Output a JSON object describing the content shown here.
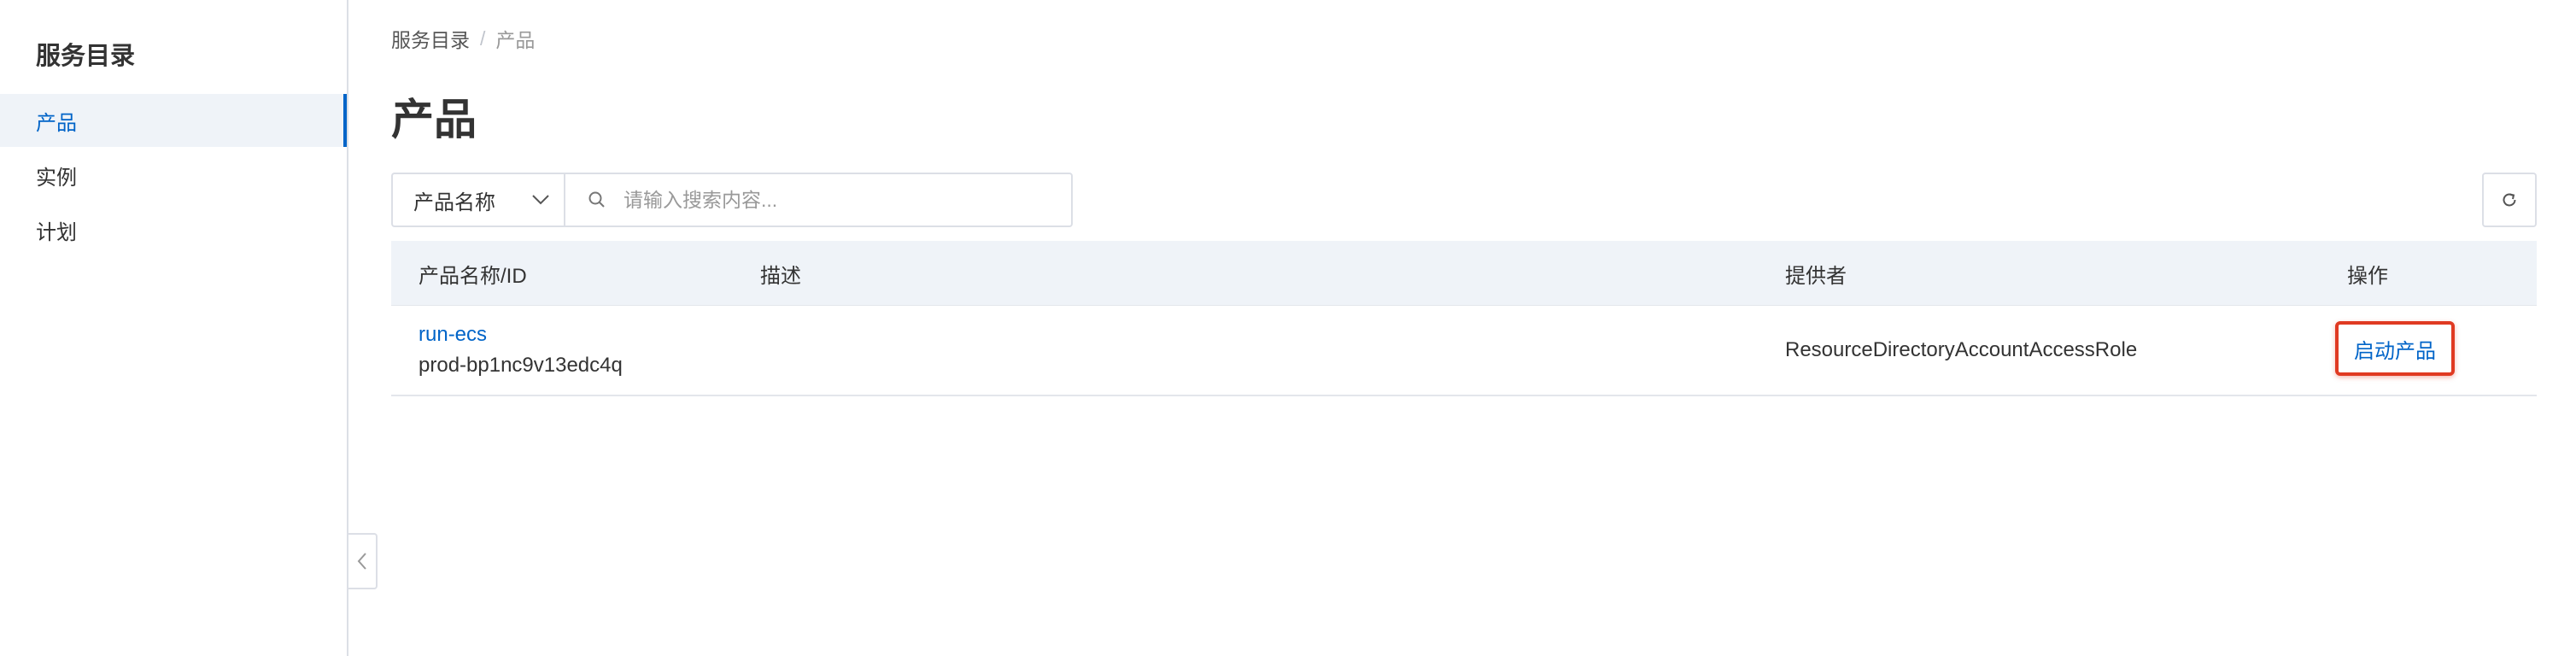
{
  "sidebar": {
    "title": "服务目录",
    "items": [
      {
        "label": "产品",
        "active": true
      },
      {
        "label": "实例",
        "active": false
      },
      {
        "label": "计划",
        "active": false
      }
    ]
  },
  "breadcrumb": {
    "root": "服务目录",
    "separator": "/",
    "current": "产品"
  },
  "page": {
    "title": "产品"
  },
  "filter": {
    "select_value": "产品名称",
    "search_placeholder": "请输入搜索内容..."
  },
  "table": {
    "headers": [
      "产品名称/ID",
      "描述",
      "提供者",
      "操作"
    ],
    "rows": [
      {
        "name": "run-ecs",
        "id": "prod-bp1nc9v13edc4q",
        "description": "",
        "provider": "ResourceDirectoryAccountAccessRole",
        "action": "启动产品"
      }
    ]
  },
  "colors": {
    "accent": "#0064c8",
    "highlight_border": "#e03a22",
    "header_bg": "#eff3f8"
  },
  "icons": [
    "chevron-down-icon",
    "search-icon",
    "refresh-icon",
    "chevron-left-icon"
  ]
}
